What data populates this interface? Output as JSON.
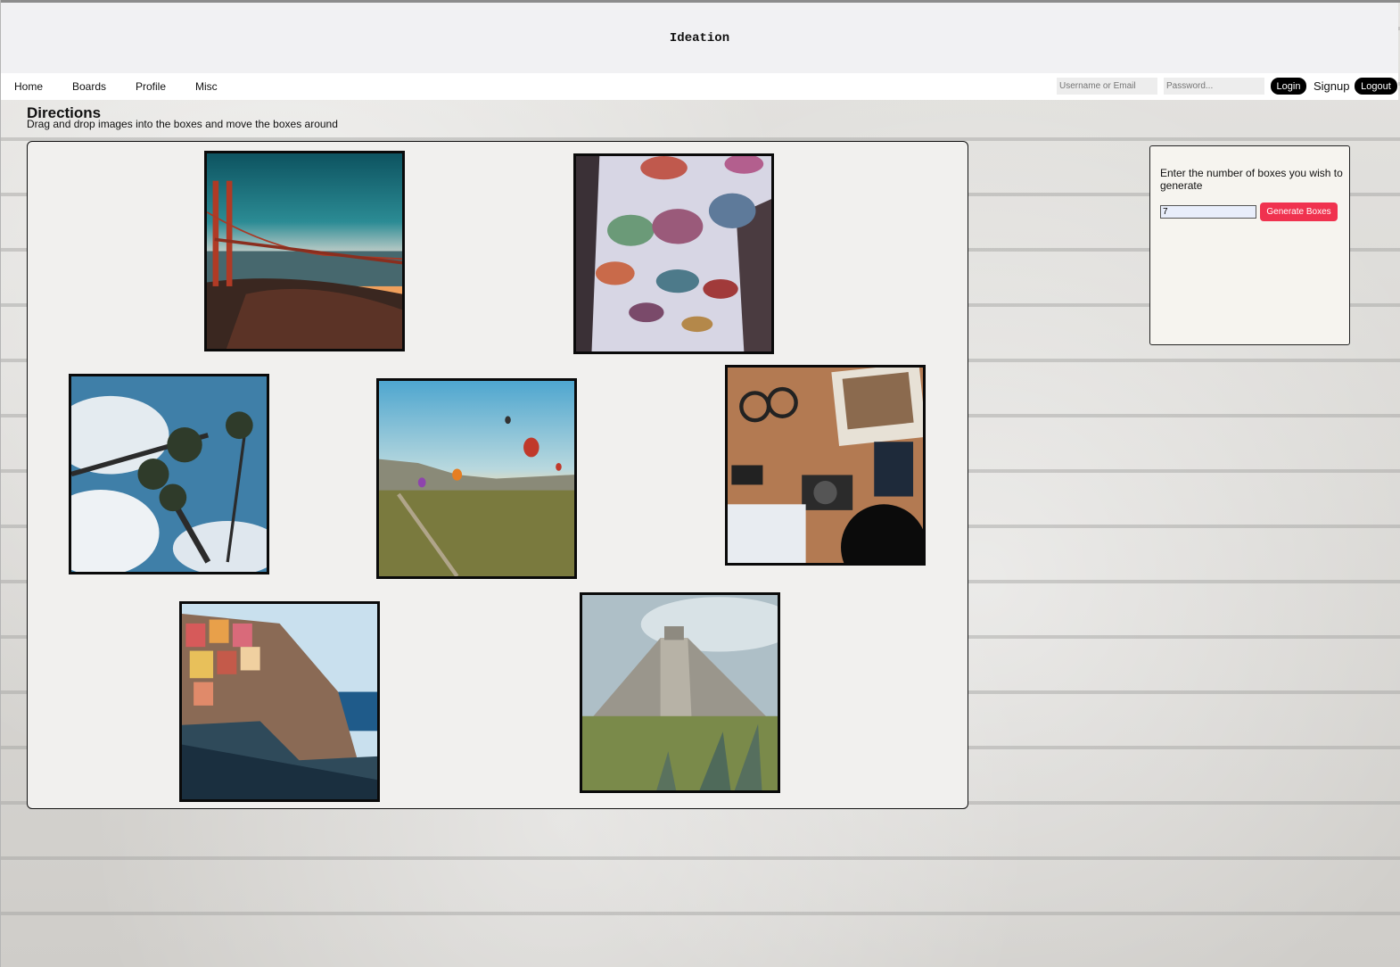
{
  "app": {
    "title": "Ideation"
  },
  "nav": {
    "links": [
      "Home",
      "Boards",
      "Profile",
      "Misc"
    ],
    "username_placeholder": "Username or Email",
    "password_placeholder": "Password...",
    "login_label": "Login",
    "signup_label": "Signup",
    "logout_label": "Logout"
  },
  "directions": {
    "title": "Directions",
    "text": "Drag and drop images into the boxes and move the boxes around"
  },
  "board": {
    "images": [
      {
        "subject": "golden-gate-bridge-photo"
      },
      {
        "subject": "hanging-umbrellas-photo"
      },
      {
        "subject": "palm-trees-photo"
      },
      {
        "subject": "hot-air-balloons-photo"
      },
      {
        "subject": "travel-flatlay-camera-photo"
      },
      {
        "subject": "cinque-terre-cliff-village-photo"
      },
      {
        "subject": "chichen-itza-pyramid-photo"
      }
    ]
  },
  "generator": {
    "prompt": "Enter the number of boxes you wish to generate",
    "count_value": "7",
    "button_label": "Generate Boxes"
  },
  "colors": {
    "header_bg": "#f1f1f3",
    "button_black": "#000000",
    "generate_button": "#f0324f",
    "board_bg": "#f1f0ee"
  }
}
